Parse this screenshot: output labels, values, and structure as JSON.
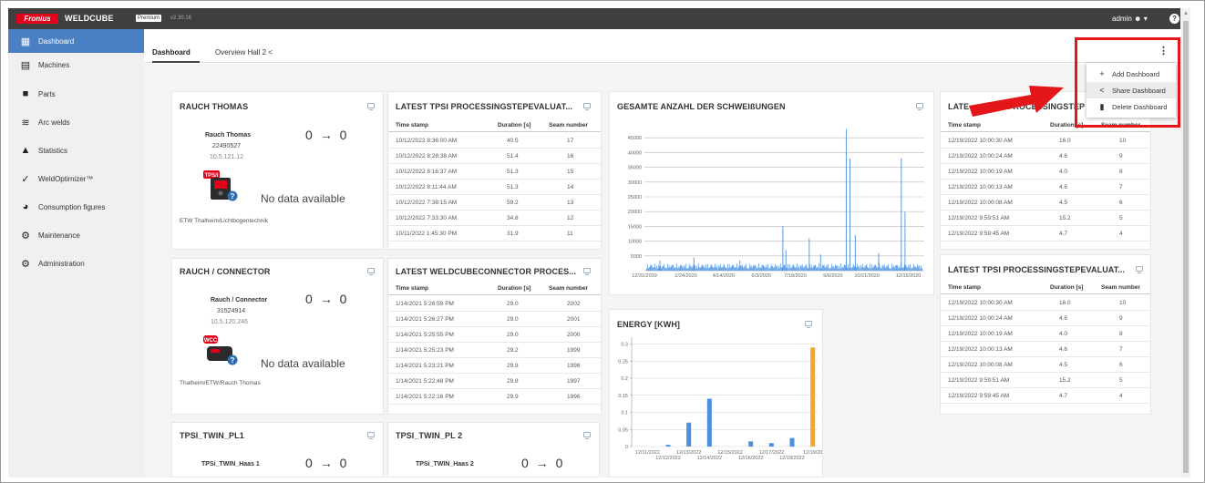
{
  "header": {
    "brand": "Fronius",
    "app_name": "WELDCUBE",
    "premium_badge": "Premium",
    "version": "v2.30.16",
    "user": "admin",
    "help": "?"
  },
  "sidebar": {
    "items": [
      {
        "label": "Dashboard",
        "icon": "dashboard-icon",
        "active": true
      },
      {
        "label": "Machines",
        "icon": "machines-icon"
      },
      {
        "label": "Parts",
        "icon": "parts-icon"
      },
      {
        "label": "Arc welds",
        "icon": "arc-welds-icon"
      },
      {
        "label": "Statistics",
        "icon": "statistics-icon"
      },
      {
        "label": "WeldOptimizer™",
        "icon": "weldoptimizer-icon"
      },
      {
        "label": "Consumption figures",
        "icon": "pie-chart-icon"
      },
      {
        "label": "Maintenance",
        "icon": "maintenance-icon"
      },
      {
        "label": "Administration",
        "icon": "gear-icon"
      }
    ]
  },
  "tabs": [
    {
      "label": "Dashboard",
      "active": true
    },
    {
      "label": "Overview Hall 2"
    }
  ],
  "menu": {
    "items": [
      {
        "label": "Add Dashboard",
        "icon": "plus-icon"
      },
      {
        "label": "Share Dashboard",
        "icon": "share-icon"
      },
      {
        "label": "Delete Dashboard",
        "icon": "trash-icon"
      }
    ]
  },
  "machines": {
    "rauch_thomas": {
      "title": "RAUCH THOMAS",
      "name": "Rauch Thomas",
      "serial": "22490527",
      "ip": "10.5.121.12",
      "from": "0",
      "arrow": "→",
      "to": "0",
      "no_data": "No data available",
      "location": "ETW Thalheim/Lichtbogentechnik",
      "badge": "TPS/i"
    },
    "rauch_connector": {
      "title": "RAUCH / CONNECTOR",
      "name": "Rauch / Connector",
      "serial": "31524914",
      "ip": "10.5.120.246",
      "from": "0",
      "arrow": "→",
      "to": "0",
      "no_data": "No data available",
      "location": "Thalheim/ETW/Rauch Thomas",
      "badge": "WCC"
    },
    "twin1": {
      "title": "TPSI_TWIN_PL1",
      "name": "TPSi_TWIN_Haas 1",
      "from": "0",
      "arrow": "→",
      "to": "0"
    },
    "twin2": {
      "title": "TPSI_TWIN_PL 2",
      "name": "TPSi_TWIN_Haas 2",
      "from": "0",
      "arrow": "→",
      "to": "0"
    }
  },
  "tables": {
    "tpsi1": {
      "title": "LATEST TPSI PROCESSINGSTEPEVALUAT...",
      "headers": [
        "Time stamp",
        "Duration [s]",
        "Seam number"
      ],
      "rows": [
        [
          "10/12/2022 8:36:00 AM",
          "40.5",
          "17"
        ],
        [
          "10/12/2022 8:28:38 AM",
          "51.4",
          "16"
        ],
        [
          "10/12/2022 8:16:37 AM",
          "51.3",
          "15"
        ],
        [
          "10/12/2022 8:11:44 AM",
          "51.3",
          "14"
        ],
        [
          "10/12/2022 7:38:15 AM",
          "59.2",
          "13"
        ],
        [
          "10/12/2022 7:33:30 AM",
          "34.8",
          "12"
        ],
        [
          "10/11/2022 1:45:30 PM",
          "31.9",
          "11"
        ]
      ]
    },
    "connector": {
      "title": "LATEST WELDCUBECONNECTOR PROCES...",
      "headers": [
        "Time stamp",
        "Duration [s]",
        "Seam number"
      ],
      "rows": [
        [
          "1/14/2021 5:26:59 PM",
          "29.0",
          "2002"
        ],
        [
          "1/14/2021 5:26:27 PM",
          "29.0",
          "2001"
        ],
        [
          "1/14/2021 5:25:55 PM",
          "29.0",
          "2000"
        ],
        [
          "1/14/2021 5:25:23 PM",
          "29.2",
          "1999"
        ],
        [
          "1/14/2021 5:23:21 PM",
          "29.8",
          "1998"
        ],
        [
          "1/14/2021 5:22:48 PM",
          "29.8",
          "1997"
        ],
        [
          "1/14/2021 5:22:16 PM",
          "29.9",
          "1996"
        ]
      ]
    },
    "right_top": {
      "title": "LATEST TPSI PROCESSINGSTEP",
      "title_visible": "LATE",
      "title_tail": "PROCESSINGSTEP",
      "headers": [
        "Time stamp",
        "Duration [s]",
        "Seam number"
      ],
      "rows": [
        [
          "12/19/2022 10:00:30 AM",
          "16.0",
          "10"
        ],
        [
          "12/19/2022 10:00:24 AM",
          "4.6",
          "9"
        ],
        [
          "12/19/2022 10:00:19 AM",
          "4.0",
          "8"
        ],
        [
          "12/19/2022 10:00:13 AM",
          "4.6",
          "7"
        ],
        [
          "12/19/2022 10:00:08 AM",
          "4.5",
          "6"
        ],
        [
          "12/19/2022 9:59:51 AM",
          "15.2",
          "5"
        ],
        [
          "12/19/2022 9:59:45 AM",
          "4.7",
          "4"
        ]
      ]
    },
    "right_bottom": {
      "title": "LATEST TPSI PROCESSINGSTEPEVALUAT...",
      "headers": [
        "Time stamp",
        "Duration [s]",
        "Seam number"
      ],
      "rows": [
        [
          "12/19/2022 10:00:30 AM",
          "16.0",
          "10"
        ],
        [
          "12/19/2022 10:00:24 AM",
          "4.6",
          "9"
        ],
        [
          "12/19/2022 10:00:19 AM",
          "4.0",
          "8"
        ],
        [
          "12/19/2022 10:00:13 AM",
          "4.6",
          "7"
        ],
        [
          "12/19/2022 10:00:08 AM",
          "4.5",
          "6"
        ],
        [
          "12/19/2022 9:59:51 AM",
          "15.2",
          "5"
        ],
        [
          "12/19/2022 9:59:45 AM",
          "4.7",
          "4"
        ]
      ]
    }
  },
  "chart_data": [
    {
      "type": "bar",
      "title": "GESAMTE ANZAHL DER SCHWEIßUNGEN",
      "x_tick_labels": [
        "12/31/2019",
        "2/24/2020",
        "4/14/2020",
        "6/3/2020",
        "7/18/2020",
        "9/6/2020",
        "10/21/2020",
        "12/15/2020"
      ],
      "y_ticks": [
        5000,
        10000,
        15000,
        20000,
        25000,
        30000,
        35000,
        40000,
        45000
      ],
      "ylim": [
        0,
        50000
      ],
      "color": "#4a8fe0",
      "peaks": [
        {
          "x": "1/20/2020",
          "value": 3500
        },
        {
          "x": "3/5/2020",
          "value": 4500
        },
        {
          "x": "5/5/2020",
          "value": 3500
        },
        {
          "x": "7/1/2020",
          "value": 15000
        },
        {
          "x": "7/5/2020",
          "value": 7000
        },
        {
          "x": "8/5/2020",
          "value": 11000
        },
        {
          "x": "8/20/2020",
          "value": 5500
        },
        {
          "x": "9/23/2020",
          "value": 48000
        },
        {
          "x": "9/28/2020",
          "value": 38000
        },
        {
          "x": "10/5/2020",
          "value": 12000
        },
        {
          "x": "11/5/2020",
          "value": 6000
        },
        {
          "x": "12/5/2020",
          "value": 38000
        },
        {
          "x": "12/10/2020",
          "value": 20000
        }
      ],
      "baseline_typical": 2500
    },
    {
      "type": "bar",
      "title": "ENERGY [KWH]",
      "categories": [
        "12/11/2022",
        "12/12/2022",
        "12/13/2022",
        "12/14/2022",
        "12/15/2022",
        "12/16/2022",
        "12/17/2022",
        "12/18/2022",
        "12/19/20"
      ],
      "values": [
        0,
        0.005,
        0.07,
        0.14,
        0,
        0.015,
        0.01,
        0.025,
        0.29
      ],
      "highlight_last": true,
      "y_ticks": [
        "0",
        "0.05",
        "0.1",
        "0.15",
        "0.2",
        "0.25",
        "0.3"
      ],
      "ylim": [
        0,
        0.32
      ],
      "colors": {
        "bar": "#4a8fe0",
        "highlight": "#f5a623"
      }
    }
  ]
}
